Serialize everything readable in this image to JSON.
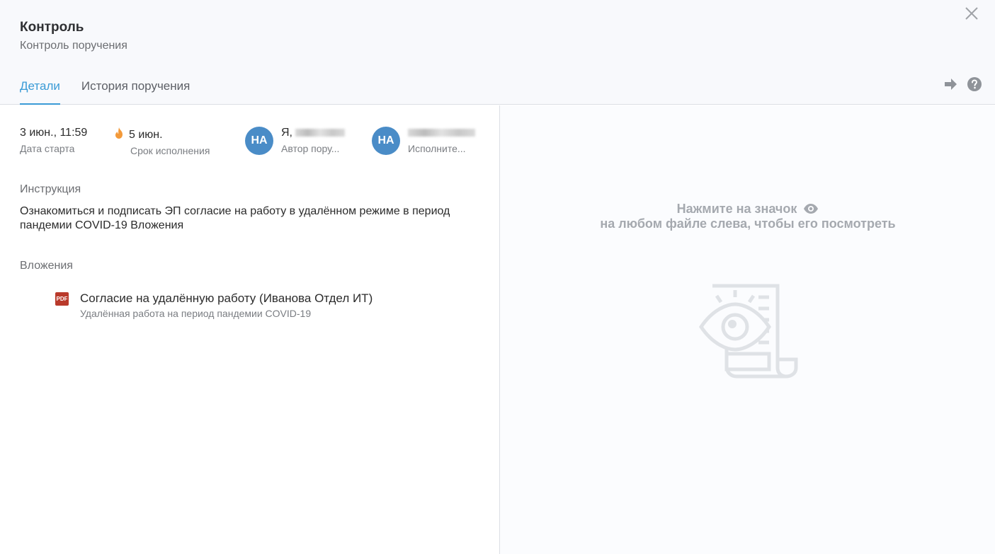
{
  "header": {
    "title": "Контроль",
    "subtitle": "Контроль поручения",
    "tabs": [
      {
        "label": "Детали",
        "active": true
      },
      {
        "label": "История поручения",
        "active": false
      }
    ],
    "icons": [
      "close-icon",
      "forward-arrow-icon",
      "help-icon"
    ]
  },
  "meta": {
    "start": {
      "value": "3 июн., 11:59",
      "label": "Дата старта"
    },
    "deadline": {
      "value": "5 июн.",
      "label": "Срок исполнения",
      "icon": "fire-icon"
    },
    "author": {
      "initials": "НА",
      "name_prefix": "Я,",
      "label": "Автор пору..."
    },
    "executor": {
      "initials": "НА",
      "label": "Исполните..."
    }
  },
  "instruction": {
    "label": "Инструкция",
    "text": "Ознакомиться и подписать ЭП согласие на работу в удалённом режиме в период пандемии COVID-19 Вложения"
  },
  "attachments": {
    "label": "Вложения",
    "items": [
      {
        "type_badge": "PDF",
        "name": "Согласие на удалённую работу (Иванова Отдел ИТ)",
        "description": "Удалённая работа на период пандемии COVID-19"
      }
    ]
  },
  "preview": {
    "hint_line1": "Нажмите на значок",
    "hint_line2": "на любом файле слева, чтобы его посмотреть"
  },
  "colors": {
    "accent": "#3a9bd6",
    "avatar": "#4a8cc7",
    "fire": "#f39a3a",
    "pdf": "#b93a2b"
  }
}
